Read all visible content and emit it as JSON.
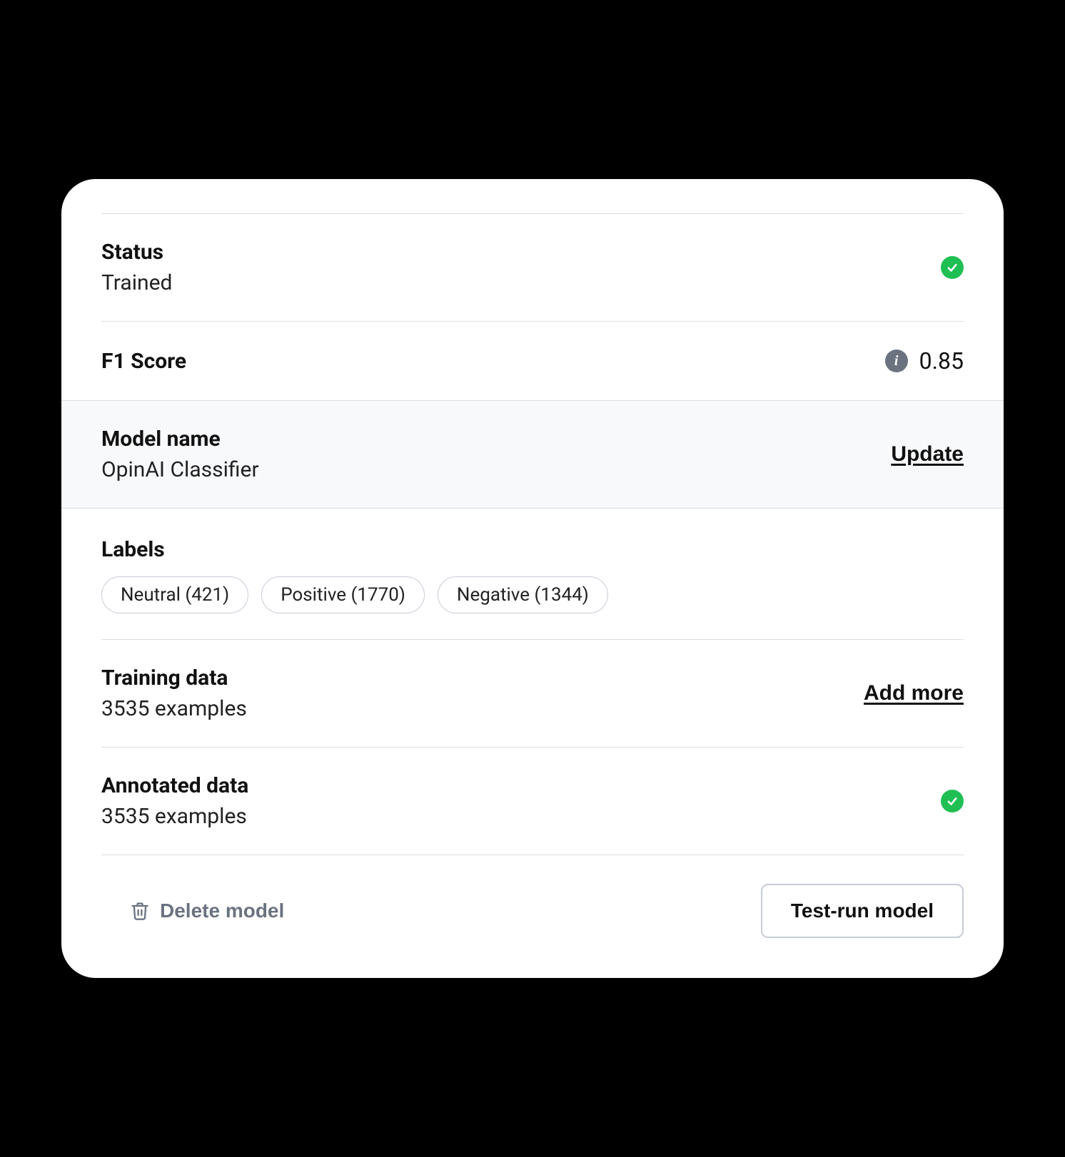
{
  "status": {
    "label": "Status",
    "value": "Trained",
    "ok": true
  },
  "f1": {
    "label": "F1 Score",
    "value": "0.85"
  },
  "model": {
    "label": "Model name",
    "value": "OpinAI Classifier",
    "action": "Update"
  },
  "labels": {
    "label": "Labels",
    "items": [
      {
        "text": "Neutral (421)"
      },
      {
        "text": "Positive (1770)"
      },
      {
        "text": "Negative (1344)"
      }
    ]
  },
  "training": {
    "label": "Training data",
    "value": "3535 examples",
    "action": "Add more"
  },
  "annotated": {
    "label": "Annotated data",
    "value": "3535 examples",
    "ok": true
  },
  "footer": {
    "delete": "Delete model",
    "test": "Test-run model"
  },
  "colors": {
    "success": "#1fbf54",
    "muted": "#6b7280",
    "border": "#d9dde3"
  }
}
